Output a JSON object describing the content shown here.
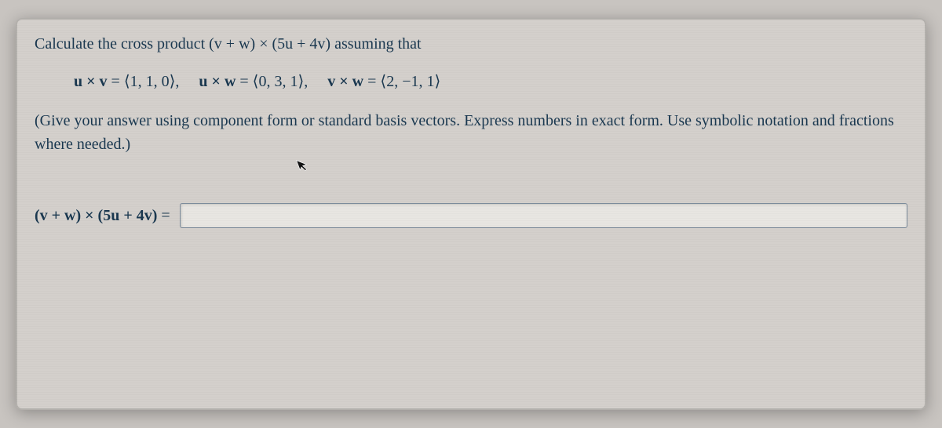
{
  "intro": "Calculate the cross product (v + w) × (5u + 4v) assuming that",
  "givens": {
    "p1_lhs": "u × v",
    "p1_eq": " = ",
    "p1_rhs": "⟨1, 1, 0⟩,",
    "p2_lhs": "u × w",
    "p2_eq": " = ",
    "p2_rhs": "⟨0, 3, 1⟩,",
    "p3_lhs": "v × w",
    "p3_eq": " = ",
    "p3_rhs": "⟨2, −1, 1⟩"
  },
  "instructions": "(Give your answer using component form or standard basis vectors. Express numbers in exact form. Use symbolic notation and fractions where needed.)",
  "answer_label_expr": "(v + w) × (5u + 4v)",
  "answer_label_eq": " = ",
  "answer_value": "",
  "answer_placeholder": ""
}
